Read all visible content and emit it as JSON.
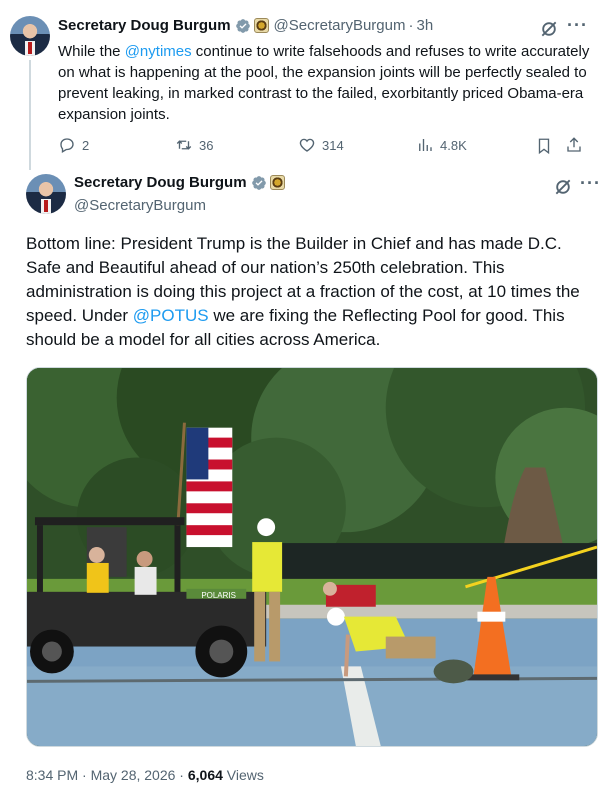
{
  "quoted_post": {
    "author_name": "Secretary Doug Burgum",
    "handle": "@SecretaryBurgum",
    "separator": "·",
    "time_ago": "3h",
    "text_part1": "While the ",
    "mention": "@nytimes",
    "text_part2": " continue to write falsehoods and refuses to write accurately on what is happening at the pool, the expansion joints will be perfectly sealed to prevent leaking, in marked contrast to the failed, exorbitantly priced Obama-era expansion joints.",
    "replies": "2",
    "reposts": "36",
    "likes": "314",
    "views": "4.8K"
  },
  "main_post": {
    "author_name": "Secretary Doug Burgum",
    "handle": "@SecretaryBurgum",
    "text_part1": "Bottom line: President Trump is the Builder in Chief and has made D.C. Safe and Beautiful ahead of our nation’s 250th celebration. This administration is doing this project at a fraction of the cost, at 10 times the speed. Under ",
    "mention": "@POTUS",
    "text_part2": " we are fixing the Reflecting Pool for good. This should be a model for all cities across America.",
    "vehicle_label": "POLARIS",
    "timestamp": "8:34 PM · May 28, 2026 · ",
    "view_count": "6,064",
    "views_label": " Views"
  },
  "colors": {
    "text": "#0f1419",
    "secondary": "#536471",
    "link": "#1d9bf0",
    "verified": "#829aab"
  },
  "icons": [
    "verified-badge-icon",
    "grok-icon",
    "more-icon",
    "reply-icon",
    "repost-icon",
    "like-icon",
    "views-icon",
    "bookmark-icon",
    "share-icon"
  ]
}
